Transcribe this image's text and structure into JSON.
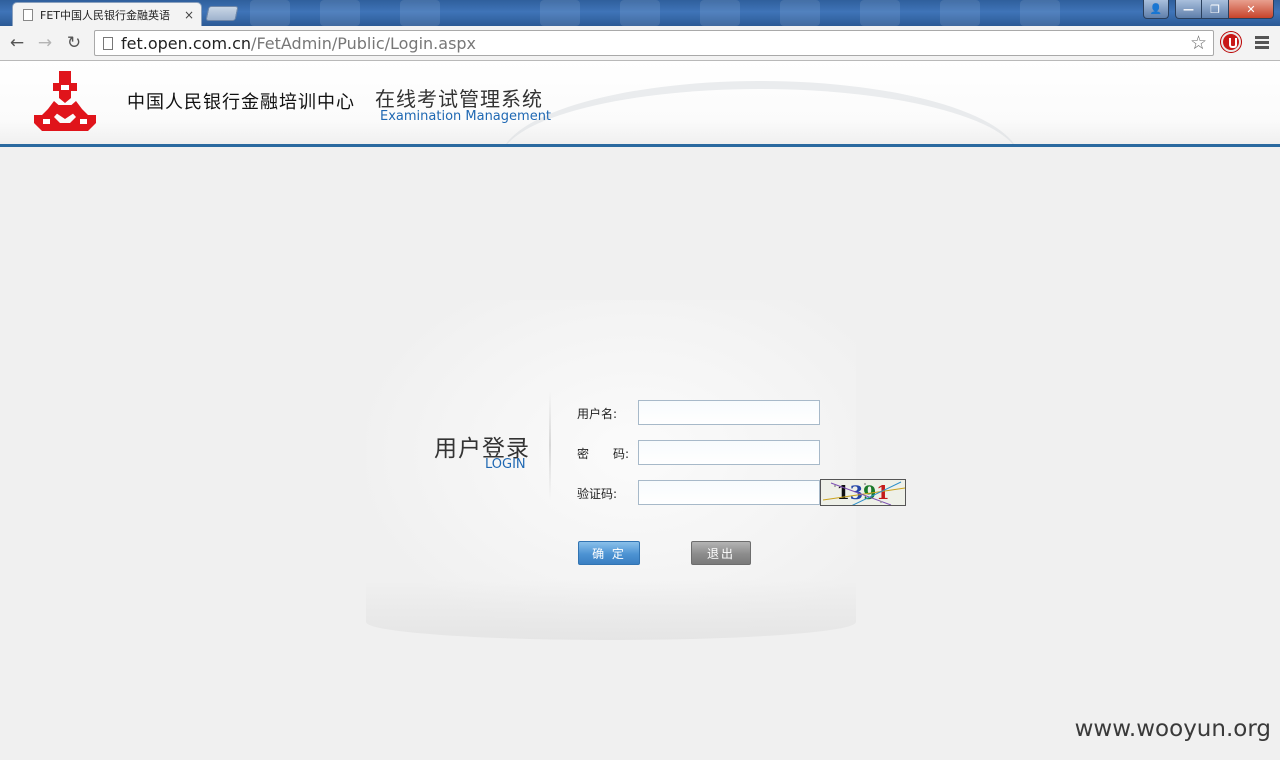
{
  "browser": {
    "tab_title": "FET中国人民银行金融英语",
    "tab_close": "×",
    "url_host": "fet.open.com.cn",
    "url_path": "/FetAdmin/Public/Login.aspx",
    "back": "←",
    "forward": "→",
    "reload": "↻",
    "star": "☆",
    "win_user": "👤",
    "win_min": "—",
    "win_max": "❐",
    "win_close": "✕"
  },
  "header": {
    "org_name": "中国人民银行金融培训中心",
    "system_name": "在线考试管理系统",
    "system_subtitle": "Examination Management",
    "logo_color": "#e0141b",
    "accent_color": "#2b6aa0"
  },
  "login": {
    "title": "用户登录",
    "subtitle": "LOGIN",
    "username_label": "用户名:",
    "username_value": "",
    "password_label": "密　　码:",
    "password_value": "",
    "captcha_label": "验证码:",
    "captcha_value": "",
    "captcha_chars": [
      "1",
      "3",
      "9",
      "1"
    ],
    "submit_label": "确 定",
    "exit_label": "退出"
  },
  "watermark": "www.wooyun.org"
}
